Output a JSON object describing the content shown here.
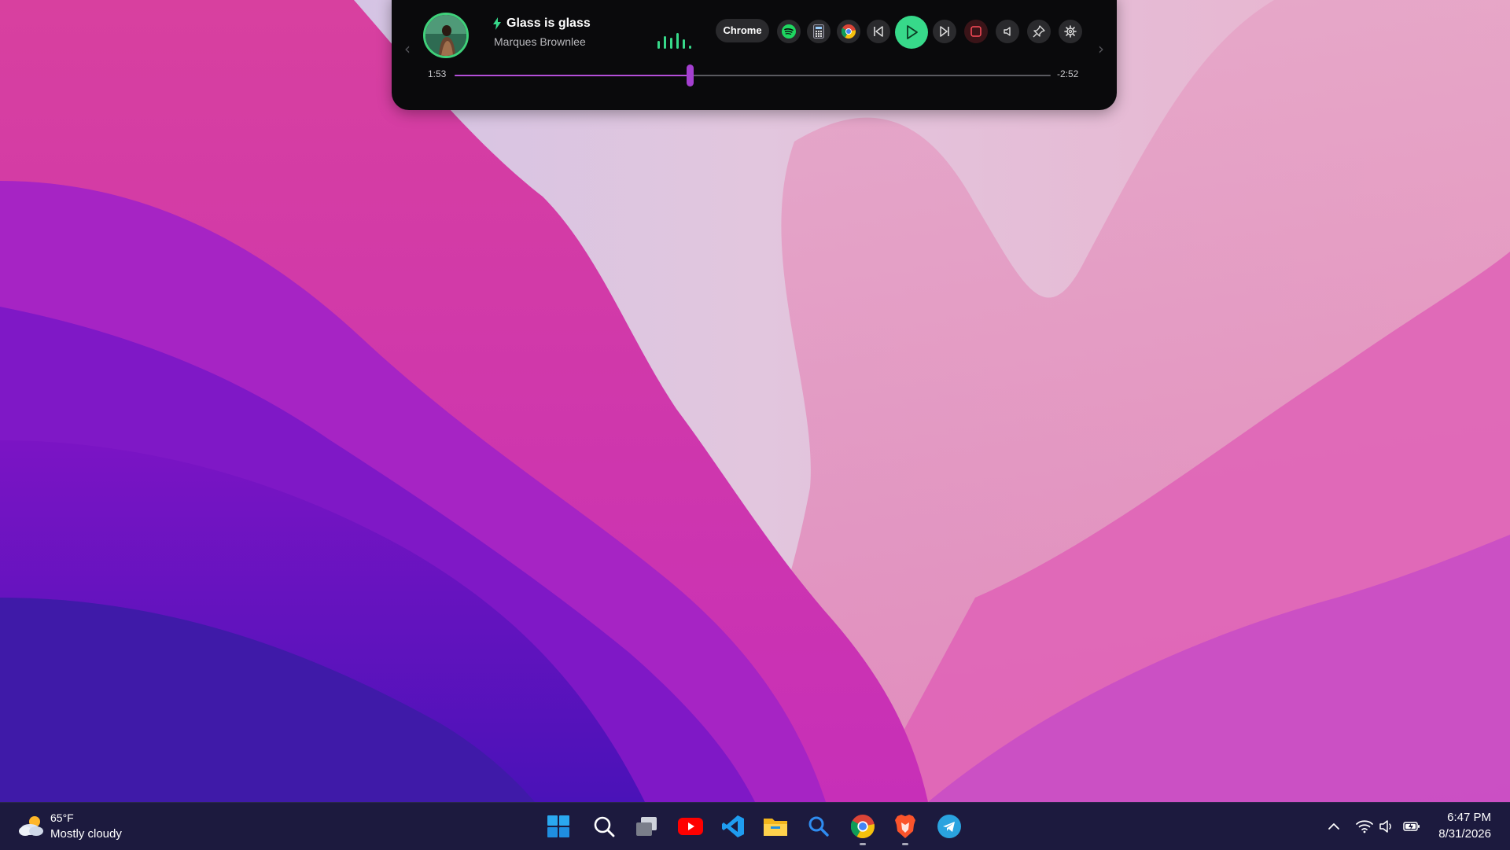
{
  "colors": {
    "accent_green": "#37d98a",
    "progress_purple": "#b44fd8",
    "widget_bg": "#0a0a0c",
    "taskbar_bg": "#1c1a3e"
  },
  "media_widget": {
    "track_title": "Glass is glass",
    "track_artist": "Marques Brownlee",
    "source_app": "Chrome",
    "time_elapsed": "1:53",
    "time_remaining": "-2:52",
    "progress_fraction": 0.394,
    "controls": [
      "spotify-icon",
      "calculator-icon",
      "chrome-icon",
      "skip-previous-icon",
      "play-icon",
      "skip-next-icon",
      "stop-icon",
      "volume-icon",
      "pin-icon",
      "gear-icon"
    ]
  },
  "taskbar": {
    "weather": {
      "temperature": "65°F",
      "condition": "Mostly cloudy",
      "icon": "partly-cloudy-icon"
    },
    "apps": [
      "windows-start-icon",
      "search-icon",
      "task-view-icon",
      "youtube-icon",
      "vscode-icon",
      "file-explorer-icon",
      "search-app-icon",
      "chrome-icon",
      "brave-icon",
      "telegram-icon"
    ],
    "tray": [
      "chevron-up-icon",
      "wifi-icon",
      "speaker-icon",
      "battery-icon"
    ],
    "clock": {
      "time": "6:47 PM",
      "date": "8/31/2026"
    }
  }
}
